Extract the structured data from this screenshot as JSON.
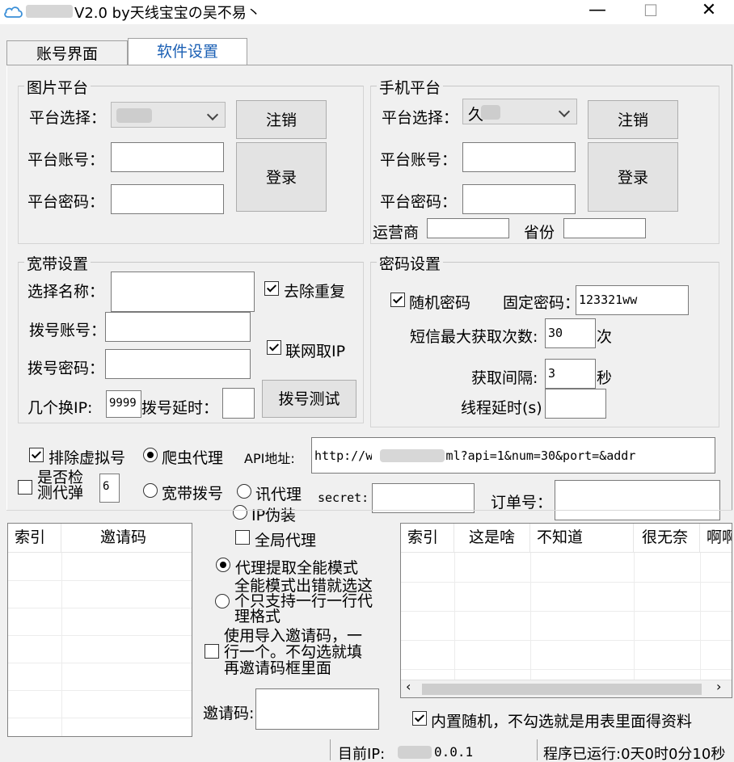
{
  "window": {
    "title": "V2.0 by天线宝宝の吴不易丶",
    "minimize": "—",
    "maximize": "☐",
    "close": "✕"
  },
  "tabs": [
    {
      "label": "账号界面",
      "active": false
    },
    {
      "label": "软件设置",
      "active": true
    }
  ],
  "image_platform": {
    "group_label": "图片平台",
    "select_label": "平台选择：",
    "selected": "",
    "account_label": "平台账号：",
    "account_value": "",
    "password_label": "平台密码：",
    "password_value": "",
    "logout_button": "注销",
    "login_button": "登录"
  },
  "phone_platform": {
    "group_label": "手机平台",
    "select_label": "平台选择：",
    "selected": "久",
    "account_label": "平台账号：",
    "account_value": "",
    "password_label": "平台密码：",
    "password_value": "",
    "logout_button": "注销",
    "login_button": "登录",
    "carrier_label": "运营商",
    "carrier_value": "",
    "province_label": "省份",
    "province_value": ""
  },
  "broadband": {
    "group_label": "宽带设置",
    "name_label": "选择名称：",
    "name_value": "",
    "dial_account_label": "拨号账号：",
    "dial_account_value": "",
    "dial_password_label": "拨号密码：",
    "dial_password_value": "",
    "switch_ip_label": "几个换IP:",
    "switch_ip_value": "9999",
    "dial_delay_label": "拨号延时：",
    "dial_delay_value": "",
    "dedupe_label": "去除重复",
    "dedupe_checked": true,
    "net_ip_label": "联网取IP",
    "net_ip_checked": true,
    "dial_test_button": "拨号测试"
  },
  "password": {
    "group_label": "密码设置",
    "random_label": "随机密码",
    "random_checked": true,
    "fixed_label": "固定密码：",
    "fixed_value": "123321ww",
    "sms_max_label": "短信最大获取次数:",
    "sms_max_value": "30",
    "sms_max_unit": "次",
    "interval_label": "获取间隔:",
    "interval_value": "3",
    "interval_unit": "秒",
    "thread_delay_label": "线程延时(s)",
    "thread_delay_value": ""
  },
  "proxy": {
    "exclude_virtual_label": "排除虚拟号",
    "exclude_virtual_checked": true,
    "crawler_proxy_label": "爬虫代理",
    "crawler_proxy_selected": true,
    "api_label": "API地址:",
    "api_value": "http://w           n/tqdl.html?api=1&num=30&port=&addr",
    "check_popup_label_1": "是否检",
    "check_popup_label_2": "测代弹",
    "check_popup_checked": false,
    "check_popup_value": "6",
    "broadband_dial_label": "宽带拨号",
    "xun_proxy_label": "讯代理",
    "ip_fake_label": "IP伪装",
    "secret_label": "secret:",
    "secret_value": "",
    "order_label": "订单号：",
    "order_value": ""
  },
  "invite_table": {
    "columns": [
      "索引",
      "邀请码"
    ],
    "rows": []
  },
  "middle_options": {
    "global_proxy_label": "全局代理",
    "global_proxy_checked": false,
    "proxy_mode_label": "代理提取全能模式",
    "proxy_mode_selected": true,
    "fallback_label_1": "全能模式出错就选这",
    "fallback_label_2": "个只支持一行一行代",
    "fallback_label_3": "理格式",
    "import_label_1": "使用导入邀请码，一",
    "import_label_2": "行一个。不勾选就填",
    "import_label_3": "再邀请码框里面",
    "import_checked": false,
    "invite_code_label": "邀请码:",
    "invite_code_value": ""
  },
  "info_table": {
    "columns": [
      "索引",
      "这是啥",
      "不知道",
      "很无奈",
      "啊啊"
    ],
    "rows": []
  },
  "builtin_random": {
    "label": "内置随机，不勾选就是用表里面得资料",
    "checked": true
  },
  "status": {
    "current_ip_label": "目前IP:",
    "current_ip_value": "0.0.1",
    "runtime": "程序已运行:0天0时0分10秒"
  },
  "colors": {
    "accent": "#1a5fb4",
    "background": "#f0f0f0"
  }
}
